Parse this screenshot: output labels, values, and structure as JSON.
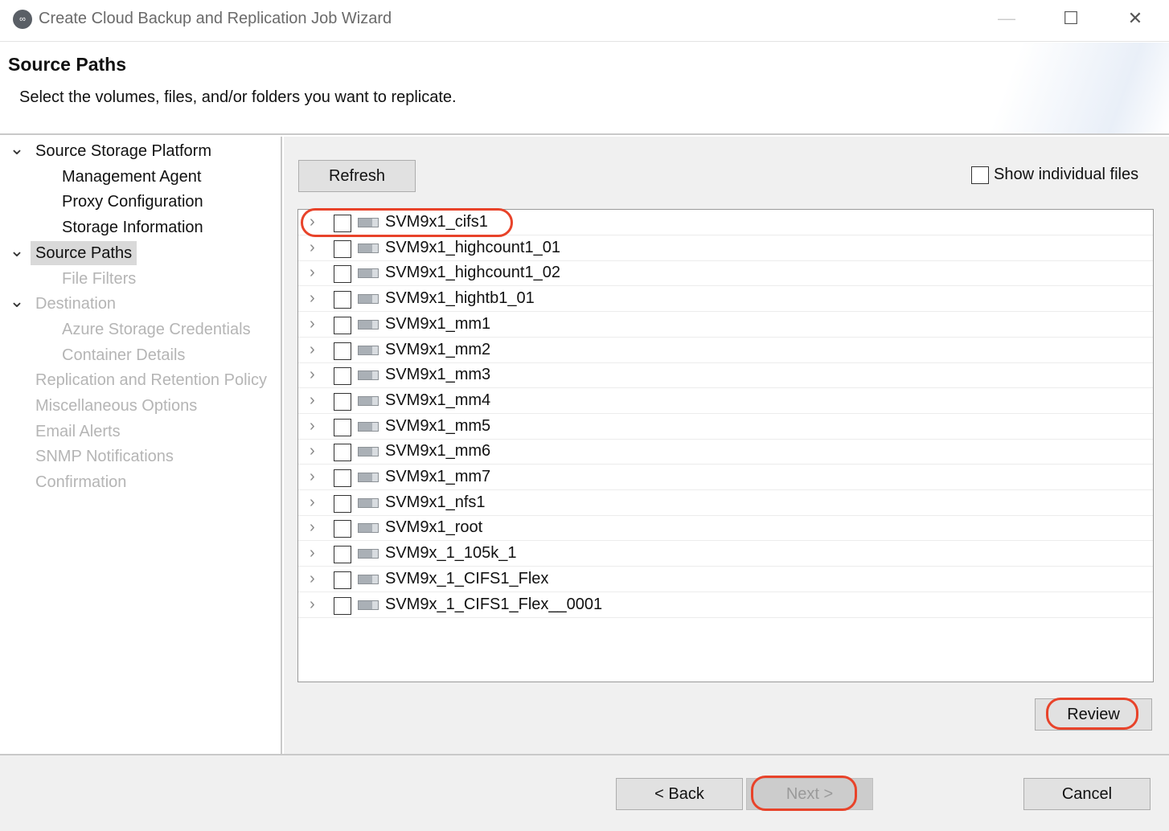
{
  "window": {
    "title": "Create Cloud Backup and Replication Job Wizard",
    "minimize": "—",
    "maximize": "☐",
    "close": "✕"
  },
  "header": {
    "title": "Source Paths",
    "subtitle": "Select the volumes, files, and/or folders you want to replicate."
  },
  "nav": [
    {
      "label": "Source Storage Platform",
      "level": 0,
      "expanded": true,
      "disabled": false
    },
    {
      "label": "Management Agent",
      "level": 1,
      "disabled": false
    },
    {
      "label": "Proxy Configuration",
      "level": 1,
      "disabled": false
    },
    {
      "label": "Storage Information",
      "level": 1,
      "disabled": false
    },
    {
      "label": "Source Paths",
      "level": 0,
      "expanded": true,
      "disabled": false,
      "selected": true
    },
    {
      "label": "File Filters",
      "level": 1,
      "disabled": true
    },
    {
      "label": "Destination",
      "level": 0,
      "expanded": true,
      "disabled": true
    },
    {
      "label": "Azure Storage Credentials",
      "level": 1,
      "disabled": true
    },
    {
      "label": "Container Details",
      "level": 1,
      "disabled": true
    },
    {
      "label": "Replication and Retention Policy",
      "level": 0,
      "disabled": true
    },
    {
      "label": "Miscellaneous Options",
      "level": 0,
      "disabled": true
    },
    {
      "label": "Email Alerts",
      "level": 0,
      "disabled": true
    },
    {
      "label": "SNMP Notifications",
      "level": 0,
      "disabled": true
    },
    {
      "label": "Confirmation",
      "level": 0,
      "disabled": true
    }
  ],
  "main": {
    "refresh_label": "Refresh",
    "show_files_label": "Show individual files",
    "show_files_checked": false,
    "review_label": "Review",
    "volumes": [
      "SVM9x1_cifs1",
      "SVM9x1_highcount1_01",
      "SVM9x1_highcount1_02",
      "SVM9x1_hightb1_01",
      "SVM9x1_mm1",
      "SVM9x1_mm2",
      "SVM9x1_mm3",
      "SVM9x1_mm4",
      "SVM9x1_mm5",
      "SVM9x1_mm6",
      "SVM9x1_mm7",
      "SVM9x1_nfs1",
      "SVM9x1_root",
      "SVM9x_1_105k_1",
      "SVM9x_1_CIFS1_Flex",
      "SVM9x_1_CIFS1_Flex__0001"
    ]
  },
  "footer": {
    "back_label": "< Back",
    "next_label": "Next >",
    "next_enabled": false,
    "cancel_label": "Cancel"
  },
  "annotation_color": "#e8432a"
}
